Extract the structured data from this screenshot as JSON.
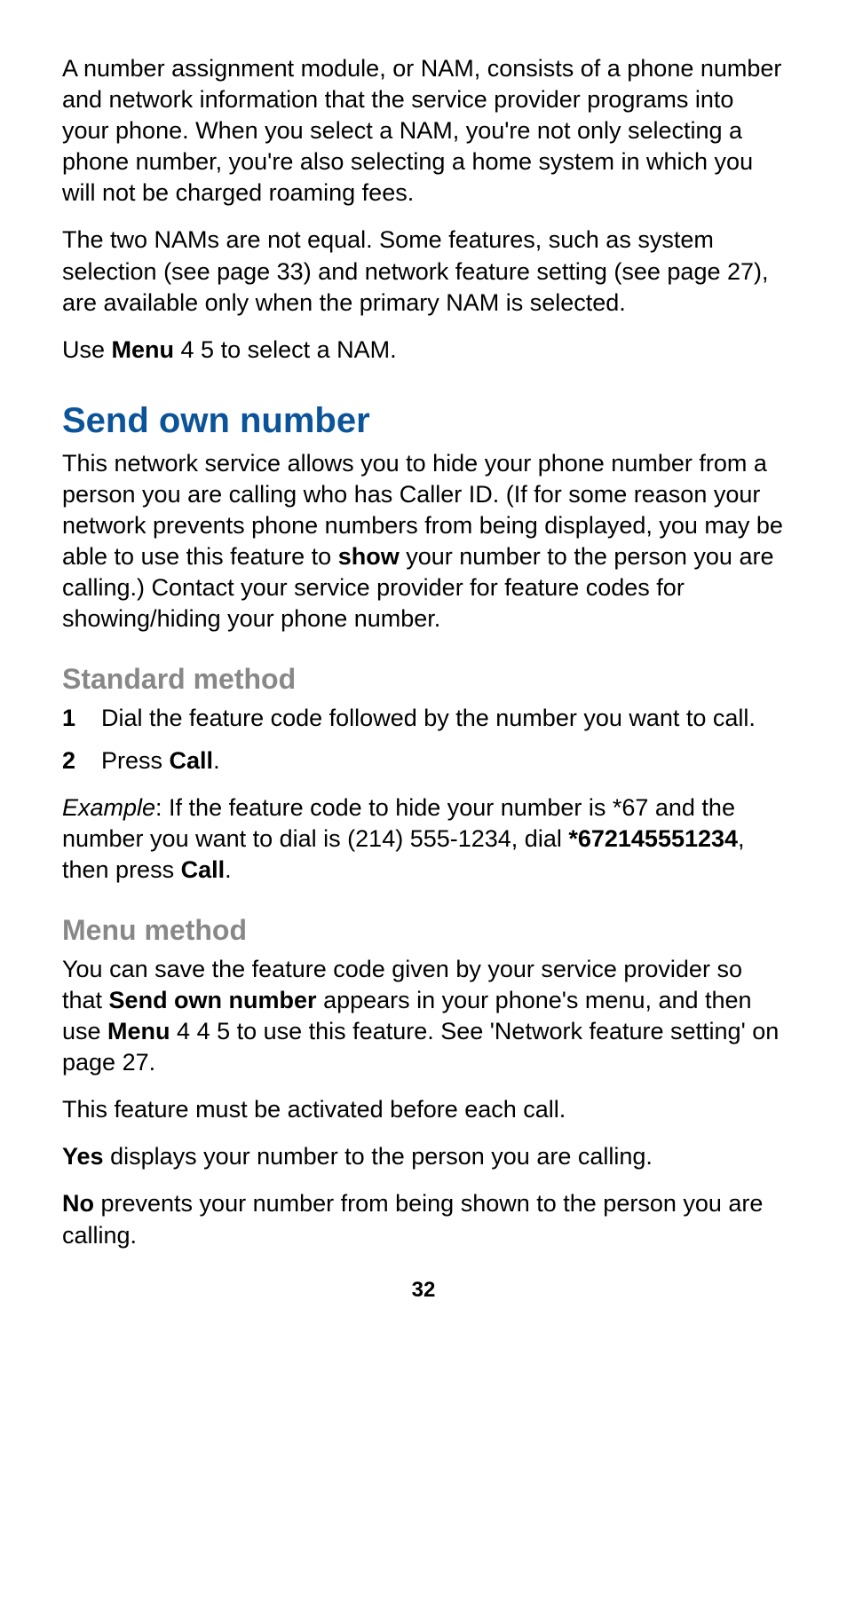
{
  "p1": "A number assignment module, or NAM, consists of a phone number and network information that the service provider programs into your phone. When you select a NAM, you're not only selecting a phone number, you're also selecting a home system in which you will not be charged roaming fees.",
  "p2": "The two NAMs are not equal. Some features, such as system selection (see page 33) and network feature setting (see page 27), are available only when the primary NAM is selected.",
  "p3_a": "Use ",
  "p3_bold": "Menu",
  "p3_b": " 4 5 to select a NAM.",
  "h1": "Send own number",
  "p4_a": "This network service allows you to hide your phone number from a person you are calling who has Caller ID. (If for some reason your network prevents phone numbers from being displayed, you may be able to use this feature to ",
  "p4_bold": "show",
  "p4_b": " your number to the person you are calling.) Contact your service provider for feature codes for showing/hiding your phone number.",
  "h2_a": "Standard method",
  "li1_num": "1",
  "li1": "Dial the feature code followed by the number you want to call.",
  "li2_num": "2",
  "li2_a": "Press ",
  "li2_bold": "Call",
  "li2_b": ".",
  "p5_italic": "Example",
  "p5_a": ":  If the feature code to hide your number is *67 and the number you want to dial is (214) 555-1234, dial ",
  "p5_bold1": "*672145551234",
  "p5_b": ", then press ",
  "p5_bold2": "Call",
  "p5_c": ".",
  "h2_b": "Menu method",
  "p6_a": "You can save the feature code given by your service provider so that ",
  "p6_bold1": "Send own number",
  "p6_b": " appears in your phone's menu, and then use ",
  "p6_bold2": "Menu",
  "p6_c": " 4 4 5 to use this feature. See 'Network feature setting' on page 27.",
  "p7": "This feature must be activated before each call.",
  "p8_bold": "Yes",
  "p8": " displays your number to the person you are calling.",
  "p9_bold": "No",
  "p9": " prevents your number from being shown to the person you are calling.",
  "page_num": "32"
}
